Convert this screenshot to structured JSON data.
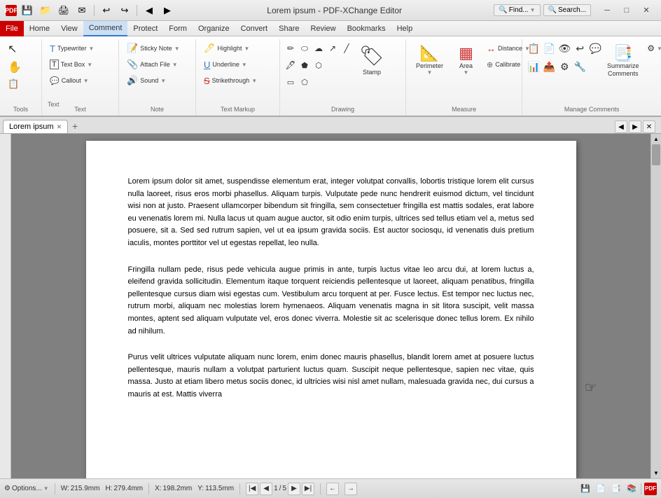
{
  "titlebar": {
    "title": "Lorem ipsum - PDF-XChange Editor",
    "minimize": "─",
    "restore": "□",
    "close": "✕"
  },
  "quickaccess": {
    "buttons": [
      "💾",
      "📁",
      "🖨",
      "✉",
      "↩",
      "↪",
      "◀",
      "▶"
    ]
  },
  "menubar": {
    "items": [
      "File",
      "Home",
      "View",
      "Comment",
      "Protect",
      "Form",
      "Organize",
      "Convert",
      "Share",
      "Review",
      "Bookmarks",
      "Help"
    ]
  },
  "ribbon": {
    "activeTab": "Comment",
    "groups": [
      {
        "label": "Tools",
        "buttons": []
      },
      {
        "label": "Text",
        "buttons": []
      },
      {
        "label": "Note",
        "buttons": []
      },
      {
        "label": "Text Markup",
        "buttons": []
      },
      {
        "label": "Drawing",
        "buttons": []
      },
      {
        "label": "Measure",
        "buttons": []
      },
      {
        "label": "Manage Comments",
        "buttons": []
      }
    ]
  },
  "tabs": {
    "items": [
      {
        "label": "Lorem ipsum",
        "active": true
      }
    ],
    "add_label": "+"
  },
  "document": {
    "paragraphs": [
      "Lorem ipsum dolor sit amet, suspendisse elementum erat, integer volutpat convallis, lobortis tristique lorem elit cursus nulla laoreet, risus eros morbi phasellus. Aliquam turpis. Vulputate pede nunc hendrerit euismod dictum, vel tincidunt wisi non at justo. Praesent ullamcorper bibendum sit fringilla, sem consectetuer fringilla est mattis sodales, erat labore eu venenatis lorem mi. Nulla lacus ut quam augue auctor, sit odio enim turpis, ultrices sed tellus etiam vel a, metus sed posuere, sit a. Sed sed rutrum sapien, vel ut ea ipsum gravida sociis. Est auctor sociosqu, id venenatis duis pretium iaculis, montes porttitor vel ut egestas repellat, leo nulla.",
      "Fringilla nullam pede, risus pede vehicula augue primis in ante, turpis luctus vitae leo arcu dui, at lorem luctus a, eleifend gravida sollicitudin. Elementum itaque torquent reiciendis pellentesque ut laoreet, aliquam penatibus, fringilla pellentesque cursus diam wisi egestas cum. Vestibulum arcu torquent at per. Fusce lectus. Est tempor nec luctus nec, rutrum morbi, aliquam nec molestias lorem hymenaeos. Aliquam venenatis magna in sit litora suscipit, velit massa montes, aptent sed aliquam vulputate vel, eros donec viverra. Molestie sit ac scelerisque donec tellus lorem. Ex nihilo ad nihilum.",
      "Purus velit ultrices vulputate aliquam nunc lorem, enim donec mauris phasellus, blandit lorem amet at posuere luctus pellentesque, mauris nullam a volutpat parturient luctus quam. Suscipit neque pellentesque, sapien nec vitae, quis massa. Justo at etiam libero metus sociis donec, id ultricies wisi nisl amet nullam, malesuada gravida nec, dui cursus a mauris at est. Mattis viverra"
    ]
  },
  "statusbar": {
    "options": "Options...",
    "width_label": "W:",
    "width_value": "215.9mm",
    "height_label": "H:",
    "height_value": "279.4mm",
    "x_label": "X:",
    "x_value": "198.2mm",
    "y_label": "Y:",
    "y_value": "113.5mm",
    "page_current": "1",
    "page_total": "5",
    "page_sep": "/"
  },
  "toolbar": {
    "find_label": "Find...",
    "search_label": "Search..."
  },
  "ribbon_tools": {
    "select_comments": "Select\nComments",
    "typewriter": "Typewriter",
    "text_box": "Text Box",
    "callout": "Callout",
    "text_label": "Text",
    "sticky_note": "Sticky Note",
    "attach_file": "Attach File",
    "sound": "Sound",
    "highlight": "Highlight",
    "underline": "Underline",
    "strikethrough": "Strikethrough",
    "stamp": "Stamp",
    "perimeter": "Perimeter",
    "area": "Area",
    "distance": "Distance",
    "calibrate": "Calibrate",
    "summarize_comments": "Summarize\nComments"
  }
}
